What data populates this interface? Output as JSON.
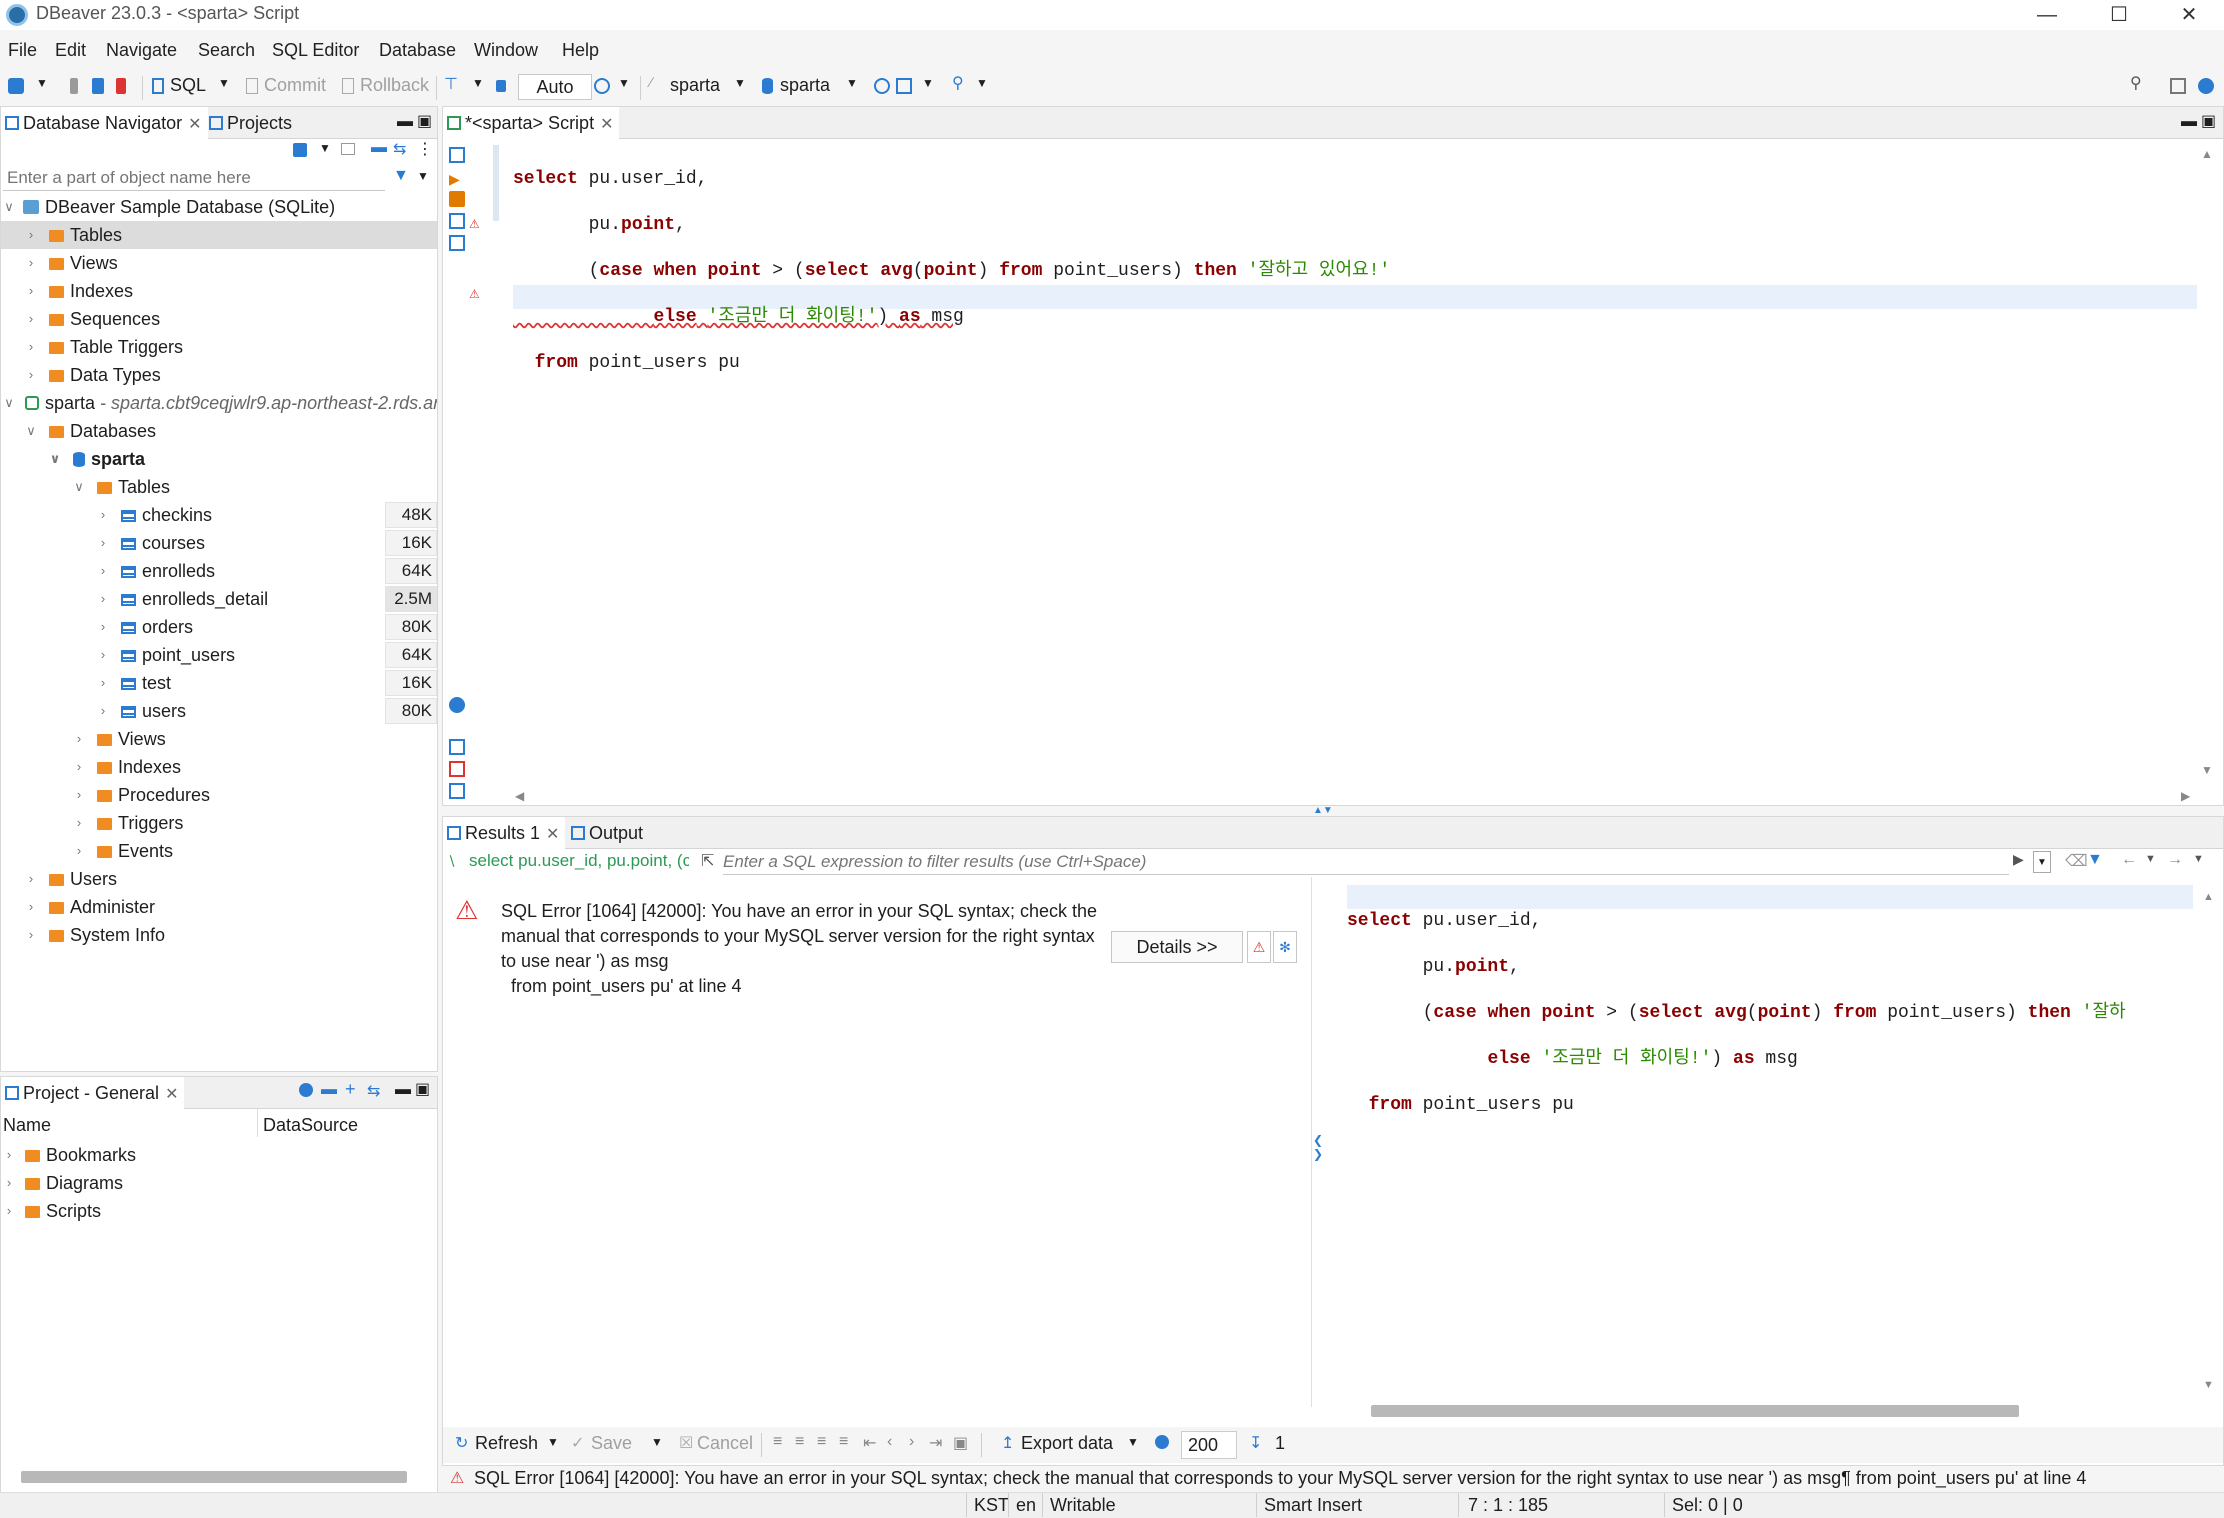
{
  "window": {
    "title": "DBeaver 23.0.3 - <sparta> Script"
  },
  "menu": [
    "File",
    "Edit",
    "Navigate",
    "Search",
    "SQL Editor",
    "Database",
    "Window",
    "Help"
  ],
  "toolbar": {
    "sql": "SQL",
    "commit": "Commit",
    "rollback": "Rollback",
    "mode": "Auto",
    "datasource": "sparta",
    "schema": "sparta"
  },
  "navigator": {
    "tab_db": "Database Navigator",
    "tab_projects": "Projects",
    "filter_placeholder": "Enter a part of object name here",
    "items": [
      {
        "label": "DBeaver Sample Database (SQLite)"
      },
      {
        "label": "Tables"
      },
      {
        "label": "Views"
      },
      {
        "label": "Indexes"
      },
      {
        "label": "Sequences"
      },
      {
        "label": "Table Triggers"
      },
      {
        "label": "Data Types"
      },
      {
        "label": "sparta",
        "detail": " - sparta.cbt9ceqjwlr9.ap-northeast-2.rds.ar"
      },
      {
        "label": "Databases"
      },
      {
        "label": "sparta"
      },
      {
        "label": "Tables"
      }
    ],
    "tables": [
      {
        "name": "checkins",
        "size": "48K"
      },
      {
        "name": "courses",
        "size": "16K"
      },
      {
        "name": "enrolleds",
        "size": "64K"
      },
      {
        "name": "enrolleds_detail",
        "size": "2.5M"
      },
      {
        "name": "orders",
        "size": "80K"
      },
      {
        "name": "point_users",
        "size": "64K"
      },
      {
        "name": "test",
        "size": "16K"
      },
      {
        "name": "users",
        "size": "80K"
      }
    ],
    "db_children": [
      "Views",
      "Indexes",
      "Procedures",
      "Triggers",
      "Events"
    ],
    "conn_children": [
      "Users",
      "Administer",
      "System Info"
    ]
  },
  "project": {
    "title": "Project - General",
    "col_name": "Name",
    "col_ds": "DataSource",
    "items": [
      "Bookmarks",
      "Diagrams",
      "Scripts"
    ]
  },
  "editor": {
    "tab": "*<sparta> Script",
    "lines": [
      "select pu.user_id,",
      "       pu.point,",
      "       (case when point > (select avg(point) from point_users) then '잘하고 있어요!'",
      "             else '조금만 더 화이팅!') as msg",
      "  from point_users pu"
    ]
  },
  "results": {
    "tab_results": "Results 1",
    "tab_output": "Output",
    "query_preview": "select pu.user_id, pu.point, (c",
    "filter_placeholder": "Enter a SQL expression to filter results (use Ctrl+Space)",
    "error_lines": [
      "SQL Error [1064] [42000]: You have an error in your SQL syntax; check the",
      "manual that corresponds to your MySQL server version for the right syntax",
      "to use near ') as msg",
      "  from point_users pu' at line 4"
    ],
    "details_button": "Details >>",
    "refresh": "Refresh",
    "save": "Save",
    "cancel": "Cancel",
    "export": "Export data",
    "fetch_size": "200",
    "row_count": "1",
    "status_error": "SQL Error [1064] [42000]: You have an error in your SQL syntax; check the manual that corresponds to your MySQL server version for the right syntax to use near ') as msg¶  from point_users pu' at line 4"
  },
  "statusbar": {
    "tz": "KST",
    "lang": "en",
    "mode": "Writable",
    "insert": "Smart Insert",
    "pos": "7 : 1 : 185",
    "sel": "Sel: 0 | 0"
  }
}
